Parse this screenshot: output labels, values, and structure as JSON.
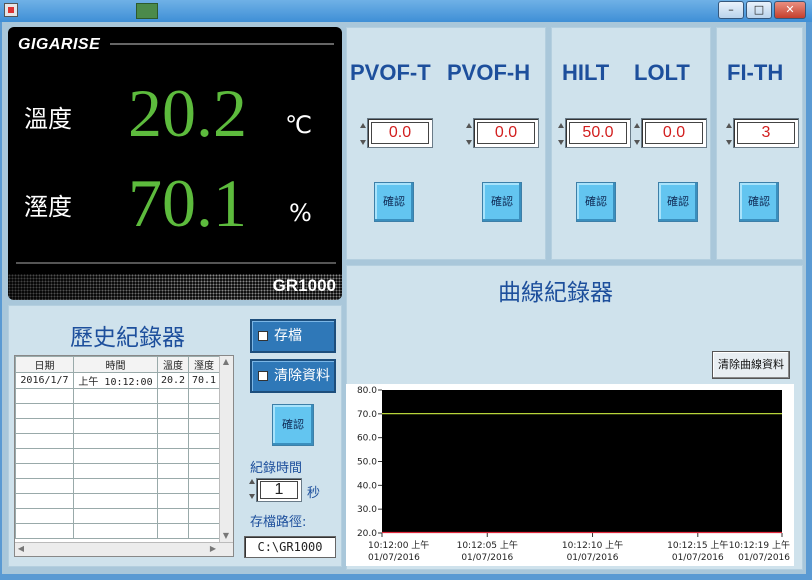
{
  "window": {
    "minimize_label": "–",
    "maximize_label": "□",
    "close_label": "✕"
  },
  "display": {
    "logo": "GIGARISE",
    "temperature": {
      "label": "溫度",
      "value": "20.2",
      "unit": "℃"
    },
    "humidity": {
      "label": "溼度",
      "value": "70.1",
      "unit": "%"
    },
    "model": "GR1000"
  },
  "settings": {
    "pvof_t": {
      "title": "PVOF-T",
      "value": "0.0"
    },
    "pvof_h": {
      "title": "PVOF-H",
      "value": "0.0"
    },
    "hilt": {
      "title": "HILT",
      "value": "50.0"
    },
    "lolt": {
      "title": "LOLT",
      "value": "0.0"
    },
    "fi_th": {
      "title": "FI-TH",
      "value": "3"
    },
    "confirm_label": "確認"
  },
  "history": {
    "title": "歷史紀錄器",
    "columns": [
      "日期",
      "時間",
      "溫度",
      "溼度"
    ],
    "rows": [
      [
        "2016/1/7",
        "上午 10:12:00",
        "20.2",
        "70.1"
      ]
    ],
    "save_label": "存檔",
    "clear_label": "清除資料",
    "confirm_label": "確認",
    "record_time_label": "紀錄時間",
    "record_time_value": "1",
    "record_time_unit": "秒",
    "save_path_label": "存檔路徑:",
    "save_path_value": "C:\\GR1000"
  },
  "chart_panel": {
    "title": "曲線紀錄器",
    "clear_label": "清除曲線資料"
  },
  "colors": {
    "accent": "#1d4f9c",
    "display_value": "#5dbb3d",
    "input_value": "#d21f1f",
    "confirm_button": "#63c5f0",
    "humidity_line": "#b7d43a",
    "temperature_line": "#e0283c"
  },
  "chart_data": {
    "type": "line",
    "ylim": [
      20.0,
      80.0
    ],
    "yticks": [
      "80.0",
      "70.0",
      "60.0",
      "50.0",
      "40.0",
      "30.0",
      "20.0"
    ],
    "xticks": [
      {
        "time": "10:12:00 上午",
        "date": "01/07/2016"
      },
      {
        "time": "10:12:05 上午",
        "date": "01/07/2016"
      },
      {
        "time": "10:12:10 上午",
        "date": "01/07/2016"
      },
      {
        "time": "10:12:15 上午",
        "date": "01/07/2016"
      },
      {
        "time": "10:12:19 上午",
        "date": "01/07/2016"
      }
    ],
    "xlim_seconds": [
      0,
      19
    ],
    "grid": false,
    "legend": "none",
    "series": [
      {
        "values": [
          70.1,
          70.1
        ],
        "color": "#b7d43a"
      },
      {
        "values": [
          20.2,
          20.2
        ],
        "color": "#e0283c"
      }
    ]
  }
}
